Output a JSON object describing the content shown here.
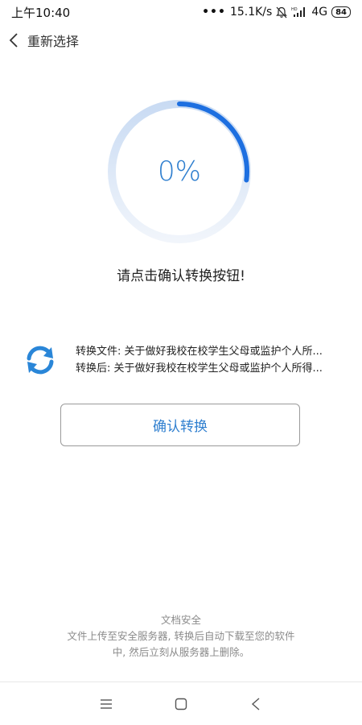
{
  "status_bar": {
    "time": "上午10:40",
    "dots": "•••",
    "network_speed": "15.1K/s",
    "hd_label": "HD",
    "network_type": "4G",
    "battery_level": "84",
    "icons": [
      "bell-muted-icon",
      "signal-icon",
      "battery-icon"
    ]
  },
  "header": {
    "back_icon": "chevron-left-icon",
    "title": "重新选择"
  },
  "progress": {
    "percent_label": "0%",
    "arc_fraction": 0.27,
    "colors": {
      "arc": "#1d6fe0",
      "track": "#e6eef8"
    }
  },
  "prompt": "请点击确认转换按钮!",
  "convert": {
    "icon": "refresh-arrows-icon",
    "source_line": "转换文件: 关于做好我校在校学生父母或监护个人所...",
    "target_line": "转换后: 关于做好我校在校学生父母或监护个人所得..."
  },
  "confirm_button": "确认转换",
  "footer": {
    "title": "文档安全",
    "line1": "文件上传至安全服务器, 转换后自动下载至您的软件",
    "line2": "中, 然后立刻从服务器上删除。"
  },
  "nav_bar": {
    "menu_icon": "menu-icon",
    "home_icon": "square-home-icon",
    "back_icon": "triangle-back-icon"
  },
  "colors": {
    "accent": "#2f7fcf",
    "text": "#222222",
    "muted": "#8a8a8a"
  }
}
